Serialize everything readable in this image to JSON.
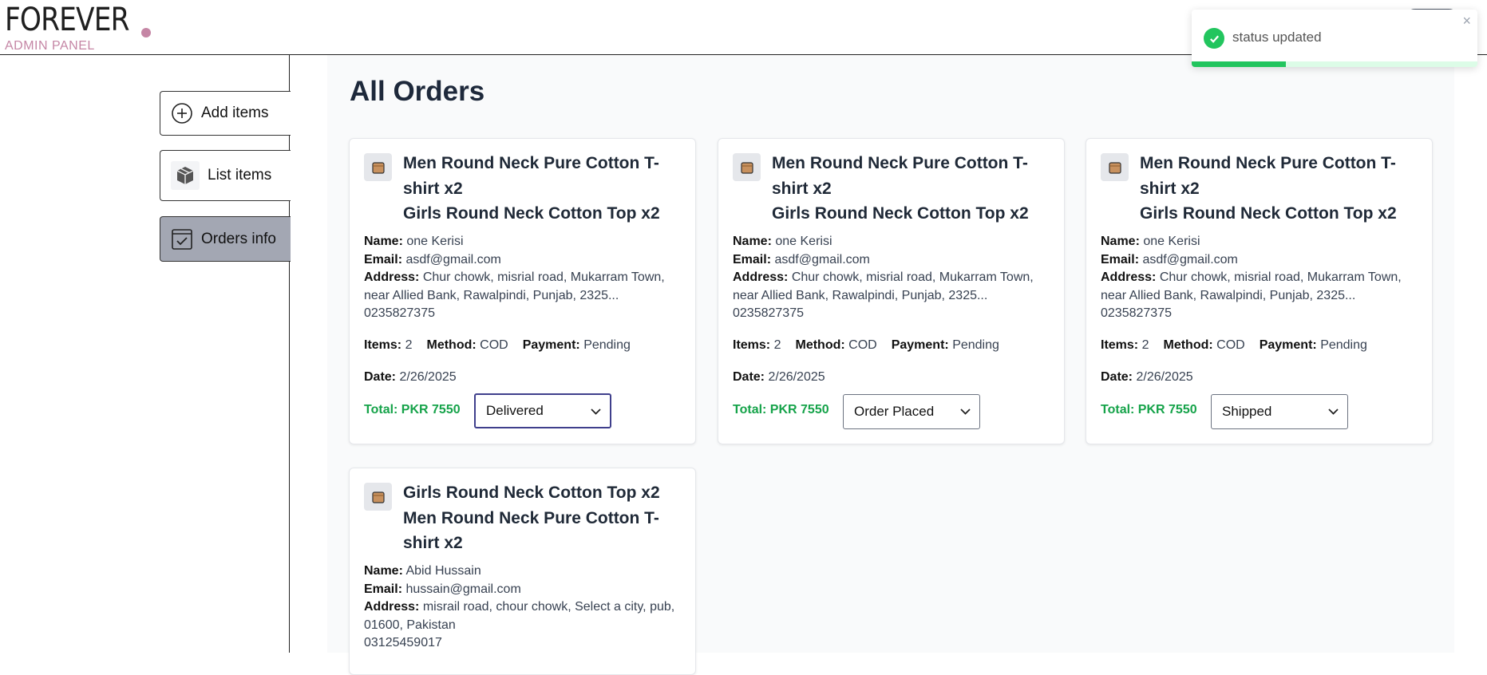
{
  "header": {
    "logo_text": "FOREVER",
    "logo_sub": "ADMIN PANEL"
  },
  "sidebar": {
    "items": [
      {
        "label": "Add items",
        "icon": "add-circle-icon"
      },
      {
        "label": "List items",
        "icon": "package-icon"
      },
      {
        "label": "Orders info",
        "icon": "orders-check-icon",
        "active": true
      }
    ]
  },
  "main": {
    "title": "All Orders",
    "orders": [
      {
        "items": [
          "Men Round Neck Pure Cotton T-shirt x2",
          "Girls Round Neck Cotton Top x2"
        ],
        "name_label": "Name:",
        "name": "one Kerisi",
        "email_label": "Email:",
        "email": "asdf@gmail.com",
        "address_label": "Address:",
        "address": "Chur chowk, misrial road, Mukarram Town, near Allied Bank, Rawalpindi, Punjab, 2325...",
        "phone": "0235827375",
        "items_label": "Items:",
        "items_count": "2",
        "method_label": "Method:",
        "method": "COD",
        "payment_label": "Payment:",
        "payment": "Pending",
        "date_label": "Date:",
        "date": "2/26/2025",
        "total": "Total: PKR 7550",
        "status": "Delivered"
      },
      {
        "items": [
          "Men Round Neck Pure Cotton T-shirt x2",
          "Girls Round Neck Cotton Top x2"
        ],
        "name_label": "Name:",
        "name": "one Kerisi",
        "email_label": "Email:",
        "email": "asdf@gmail.com",
        "address_label": "Address:",
        "address": "Chur chowk, misrial road, Mukarram Town, near Allied Bank, Rawalpindi, Punjab, 2325...",
        "phone": "0235827375",
        "items_label": "Items:",
        "items_count": "2",
        "method_label": "Method:",
        "method": "COD",
        "payment_label": "Payment:",
        "payment": "Pending",
        "date_label": "Date:",
        "date": "2/26/2025",
        "total": "Total: PKR 7550",
        "status": "Order Placed"
      },
      {
        "items": [
          "Men Round Neck Pure Cotton T-shirt x2",
          "Girls Round Neck Cotton Top x2"
        ],
        "name_label": "Name:",
        "name": "one Kerisi",
        "email_label": "Email:",
        "email": "asdf@gmail.com",
        "address_label": "Address:",
        "address": "Chur chowk, misrial road, Mukarram Town, near Allied Bank, Rawalpindi, Punjab, 2325...",
        "phone": "0235827375",
        "items_label": "Items:",
        "items_count": "2",
        "method_label": "Method:",
        "method": "COD",
        "payment_label": "Payment:",
        "payment": "Pending",
        "date_label": "Date:",
        "date": "2/26/2025",
        "total": "Total: PKR 7550",
        "status": "Shipped"
      },
      {
        "items": [
          "Girls Round Neck Cotton Top x2",
          "Men Round Neck Pure Cotton T-shirt x2"
        ],
        "name_label": "Name:",
        "name": "Abid Hussain",
        "email_label": "Email:",
        "email": "hussain@gmail.com",
        "address_label": "Address:",
        "address": "misrail road, chour chowk, Select a city, pub, 01600, Pakistan",
        "phone": "03125459017"
      }
    ]
  },
  "toast": {
    "message": "status updated",
    "close": "×",
    "progress": 0.33,
    "color": "#22c55e"
  }
}
